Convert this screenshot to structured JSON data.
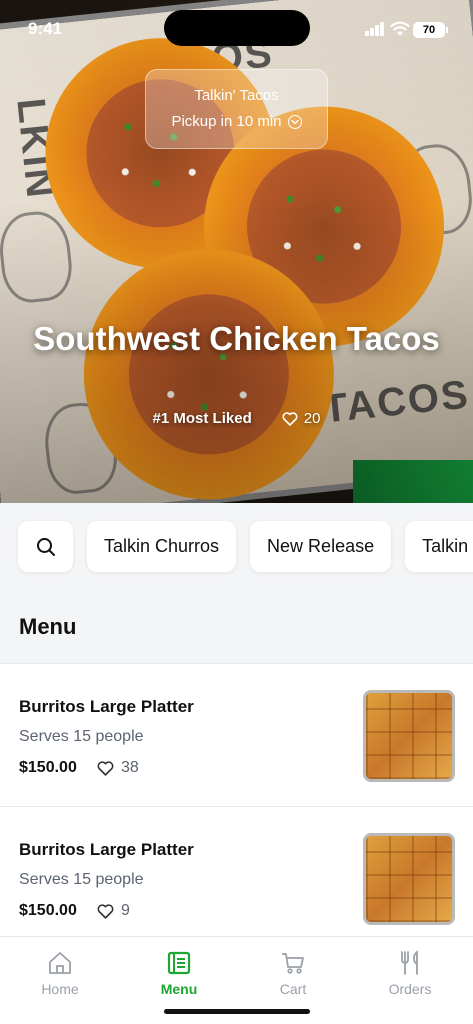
{
  "status_bar": {
    "time": "9:41",
    "battery": "70"
  },
  "hero": {
    "store_name": "Talkin' Tacos",
    "pickup": "Pickup in 10 min",
    "title": "Southwest Chicken Tacos",
    "badge": "#1 Most Liked",
    "likes": "20"
  },
  "chips": [
    "Talkin Churros",
    "New Release",
    "Talkin"
  ],
  "menu": {
    "heading": "Menu",
    "items": [
      {
        "name": "Burritos Large Platter",
        "serves": "Serves 15 people",
        "price": "$150.00",
        "likes": "38"
      },
      {
        "name": "Burritos Large Platter",
        "serves": "Serves 15 people",
        "price": "$150.00",
        "likes": "9"
      }
    ]
  },
  "tabs": [
    {
      "label": "Home",
      "icon": "home-icon",
      "active": false
    },
    {
      "label": "Menu",
      "icon": "menu-icon",
      "active": true
    },
    {
      "label": "Cart",
      "icon": "cart-icon",
      "active": false
    },
    {
      "label": "Orders",
      "icon": "fork-knife-icon",
      "active": false
    }
  ],
  "colors": {
    "accent": "#1fa533",
    "inactive": "#9aa0a8",
    "background": "#f4f5f7"
  }
}
